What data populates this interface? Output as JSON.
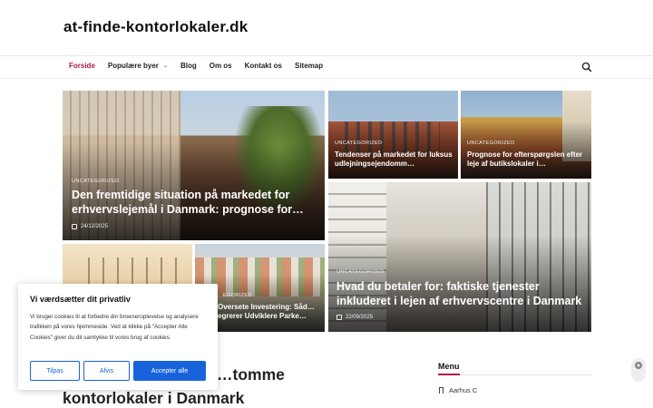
{
  "site": {
    "title": "at-finde-kontorlokaler.dk"
  },
  "nav": {
    "items": [
      {
        "label": "Forside",
        "active": true
      },
      {
        "label": "Populære byer",
        "has_dropdown": true
      },
      {
        "label": "Blog"
      },
      {
        "label": "Om os"
      },
      {
        "label": "Kontakt os"
      },
      {
        "label": "Sitemap"
      }
    ],
    "search_icon": "search-icon"
  },
  "cards": [
    {
      "category": "UNCATEGORIZED",
      "title": "Den fremtidige situation på markedet for erhvervslejemål i Danmark: prognose for…",
      "date": "24/12/2025"
    },
    {
      "category": "UNCATEGORIZED",
      "title": "Tendenser på markedet for luksus udlejningsejendomm…"
    },
    {
      "category": "UNCATEGORIZED",
      "title": "Prognose for efterspørgslen efter leje af butikslokaler i…"
    },
    {
      "category": "UNCATEGORIZED",
      "title": "Hvad du betaler for: faktiske tjenester inkluderet i lejen af erhvervscentre i Danmark",
      "date": "22/09/2025"
    },
    {
      "category": "",
      "title": ""
    },
    {
      "category": "…EGORIZED",
      "title": "Oversete Investering: Såd…egrerer Udviklere Parke…"
    }
  ],
  "cookie": {
    "heading": "Vi værdsætter dit privatliv",
    "body": "Vi bruger cookies til at forbedre din browseroplevelse og analysere trafikken på vores hjemmeside. Ved at klikke på \"Accepter Alle Cookies\" giver du dit samtykke til vores brug af cookies.",
    "customize": "Tilpas",
    "reject": "Afvis",
    "accept": "Accepter alle"
  },
  "post": {
    "title_visible": "…tomme kontorlokaler i Danmark"
  },
  "sidebar": {
    "menu_heading": "Menu",
    "menu_items": [
      "Aarhus C"
    ]
  },
  "colors": {
    "accent": "#b0174b",
    "cookie_blue": "#1863dc"
  }
}
